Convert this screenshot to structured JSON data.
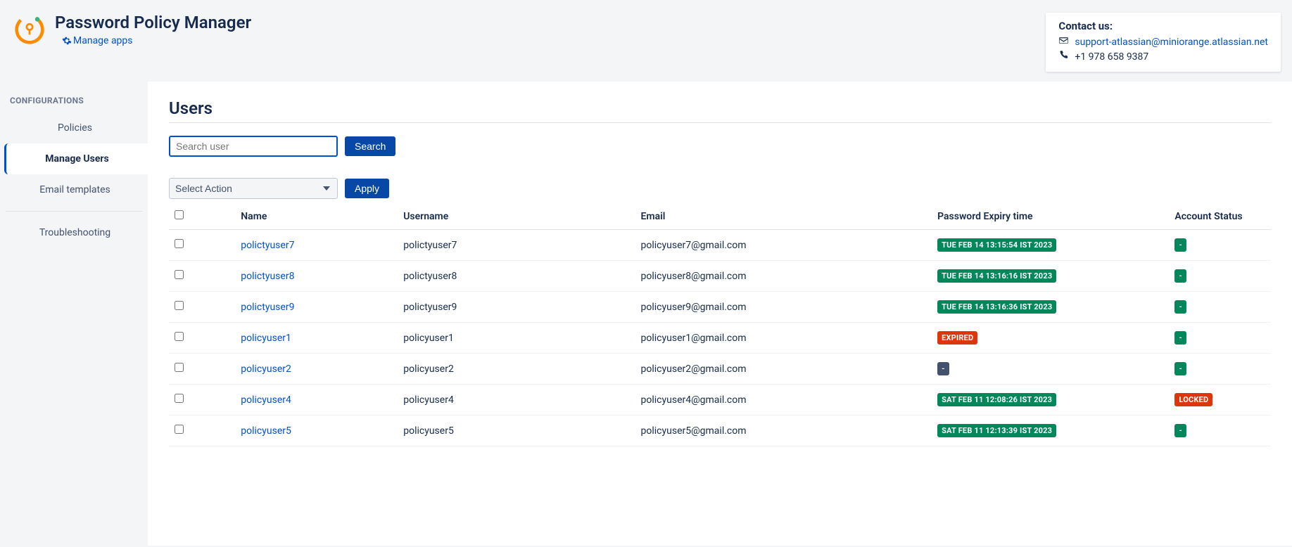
{
  "header": {
    "app_title": "Password Policy Manager",
    "manage_apps": "Manage apps"
  },
  "contact": {
    "title": "Contact us:",
    "email": "support-atlassian@miniorange.atlassian.net",
    "phone": "+1 978 658 9387"
  },
  "sidebar": {
    "section": "CONFIGURATIONS",
    "items": [
      "Policies",
      "Manage Users",
      "Email templates",
      "Troubleshooting"
    ],
    "active_index": 1
  },
  "page": {
    "title": "Users",
    "search_placeholder": "Search user",
    "search_button": "Search",
    "action_select": "Select Action",
    "apply_button": "Apply"
  },
  "table": {
    "headers": [
      "Name",
      "Username",
      "Email",
      "Password Expiry time",
      "Account Status"
    ],
    "rows": [
      {
        "name": "polictyuser7",
        "username": "polictyuser7",
        "email": "policyuser7@gmail.com",
        "expiry": {
          "text": "TUE FEB 14 13:15:54 IST 2023",
          "style": "green"
        },
        "status": {
          "text": "-",
          "style": "green"
        }
      },
      {
        "name": "polictyuser8",
        "username": "polictyuser8",
        "email": "policyuser8@gmail.com",
        "expiry": {
          "text": "TUE FEB 14 13:16:16 IST 2023",
          "style": "green"
        },
        "status": {
          "text": "-",
          "style": "green"
        }
      },
      {
        "name": "polictyuser9",
        "username": "polictyuser9",
        "email": "policyuser9@gmail.com",
        "expiry": {
          "text": "TUE FEB 14 13:16:36 IST 2023",
          "style": "green"
        },
        "status": {
          "text": "-",
          "style": "green"
        }
      },
      {
        "name": "policyuser1",
        "username": "policyuser1",
        "email": "policyuser1@gmail.com",
        "expiry": {
          "text": "EXPIRED",
          "style": "red"
        },
        "status": {
          "text": "-",
          "style": "green"
        }
      },
      {
        "name": "policyuser2",
        "username": "policyuser2",
        "email": "policyuser2@gmail.com",
        "expiry": {
          "text": "-",
          "style": "gray"
        },
        "status": {
          "text": "-",
          "style": "green"
        }
      },
      {
        "name": "policyuser4",
        "username": "policyuser4",
        "email": "policyuser4@gmail.com",
        "expiry": {
          "text": "SAT FEB 11 12:08:26 IST 2023",
          "style": "green"
        },
        "status": {
          "text": "LOCKED",
          "style": "red"
        }
      },
      {
        "name": "policyuser5",
        "username": "policyuser5",
        "email": "policyuser5@gmail.com",
        "expiry": {
          "text": "SAT FEB 11 12:13:39 IST 2023",
          "style": "green"
        },
        "status": {
          "text": "-",
          "style": "green"
        }
      }
    ]
  }
}
